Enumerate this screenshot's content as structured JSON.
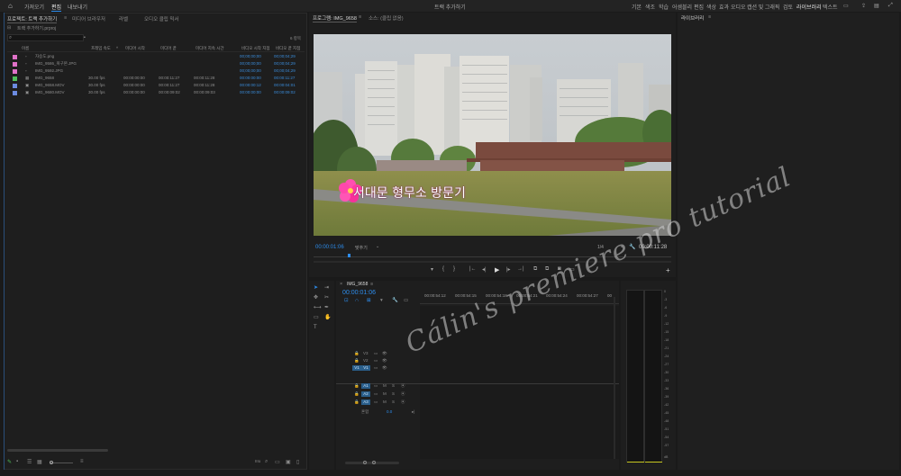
{
  "menubar": {
    "home_icon": "home-icon",
    "tabs": [
      "가져오기",
      "편집",
      "내보내기"
    ],
    "active_tab": "편집",
    "title": "트랙 추가하기",
    "workspaces": [
      "기본",
      "색조",
      "학습",
      "어셈블리",
      "편집",
      "색상",
      "효과",
      "오디오",
      "캡션 및 그래픽",
      "검토",
      "라이브러리",
      "텍스트"
    ],
    "active_workspace": "라이브러리"
  },
  "project_panel": {
    "tabs": [
      "프로젝트: 트랙 추가하기",
      "미디어 브라우저",
      "라벨",
      "오디오 클립 믹서"
    ],
    "path": "트랙 추가하기.prproj",
    "search_placeholder": "",
    "item_count": "6 항목",
    "columns": [
      "이름",
      "프레임 속도",
      "미디어 시작",
      "미디어 끝",
      "미디어 지속 시간",
      "비디오 시작 지점",
      "비디오 끝 지점"
    ],
    "items": [
      {
        "color": "#e071c8",
        "name": "자승도.png",
        "fps": "",
        "start": "",
        "end": "",
        "duration": "",
        "vstart": "00;00;00;00",
        "vend": "00;00;04;29"
      },
      {
        "color": "#e071c8",
        "name": "IMG_9586_복구본.JPG",
        "fps": "",
        "start": "",
        "end": "",
        "duration": "",
        "vstart": "00;00;00;00",
        "vend": "00;00;04;29"
      },
      {
        "color": "#e071c8",
        "name": "IMG_9592.JPG",
        "fps": "",
        "start": "",
        "end": "",
        "duration": "",
        "vstart": "00;00;00;00",
        "vend": "00;00;04;29"
      },
      {
        "color": "#4fbf5a",
        "name": "IMG_9658",
        "fps": "30.00 fps",
        "start": "00:00:00:00",
        "end": "00:00:11:27",
        "duration": "00:00:11:28",
        "vstart": "00:00:00:00",
        "vend": "00:00:11:27"
      },
      {
        "color": "#6c8be0",
        "name": "IMG_9658.MOV",
        "fps": "30.00 fps",
        "start": "00:00:00:00",
        "end": "00:00:11:27",
        "duration": "00:00:11:28",
        "vstart": "00:00:00:12",
        "vend": "00:00:04:01"
      },
      {
        "color": "#6c8be0",
        "name": "IMG_9680.MOV",
        "fps": "30.00 fps",
        "start": "00:00:00:00",
        "end": "00:00:09:02",
        "duration": "00:00:09:03",
        "vstart": "00:00:00:00",
        "vend": "00:00:09:02"
      }
    ]
  },
  "program_monitor": {
    "tabs": [
      "프로그램: IMG_9658",
      "소스: (클립 없음)"
    ],
    "timecode": "00:00:01:06",
    "fit": "맞추기",
    "resolution": "1/4",
    "duration": "00:00:11:28",
    "overlay_text": "서대문 형무소 방문기"
  },
  "right_panel": {
    "title": "라이브러리"
  },
  "timeline": {
    "sequence": "IMG_9658",
    "timecode": "00:00:01:06",
    "ruler": [
      "00:00:54:12",
      "00:00:54:15",
      "00:00:54:18",
      "00:00:54:21",
      "00:00:54:24",
      "00:00:54:27",
      "00"
    ],
    "video_tracks": [
      "V3",
      "V2",
      "V1"
    ],
    "audio_tracks": [
      "A1",
      "A2",
      "A3"
    ],
    "mix_label": "혼합",
    "mix_value": "0.0"
  },
  "meter_scale": [
    "0",
    "-3",
    "-6",
    "-9",
    "-12",
    "-15",
    "-18",
    "-21",
    "-24",
    "-27",
    "-30",
    "-33",
    "-36",
    "-39",
    "-42",
    "-45",
    "-48",
    "-51",
    "-54",
    "-57",
    "dB"
  ],
  "watermark": "Cálin's premiere pro tutorial",
  "colors": {
    "accent": "#2d8ceb",
    "video_label": "#e071c8",
    "timecode_blue": "#2d8ceb"
  }
}
